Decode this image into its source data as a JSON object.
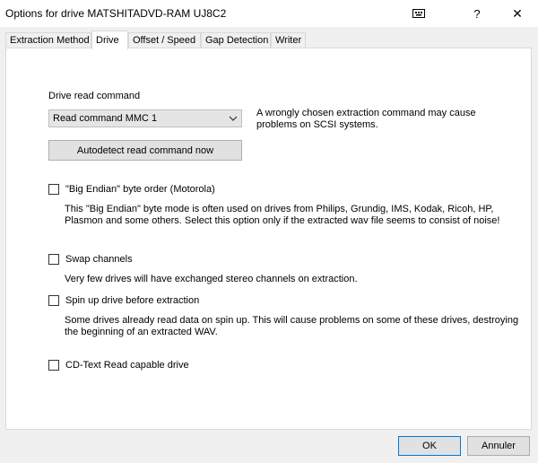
{
  "window": {
    "title": "Options for drive MATSHITADVD-RAM UJ8C2",
    "help_label": "?",
    "close_label": "✕"
  },
  "tabs": [
    {
      "label": "Extraction Method"
    },
    {
      "label": "Drive"
    },
    {
      "label": "Offset / Speed"
    },
    {
      "label": "Gap Detection"
    },
    {
      "label": "Writer"
    }
  ],
  "drive": {
    "read_command_label": "Drive read command",
    "read_command_value": "Read command MMC 1",
    "read_command_warning_1": "A wrongly chosen extraction command may cause",
    "read_command_warning_2": "problems on SCSI systems.",
    "autodetect_label": "Autodetect read command now",
    "big_endian_label": "\"Big Endian\" byte order (Motorola)",
    "big_endian_desc_1": "This \"Big Endian\" byte mode is often used on drives from Philips, Grundig, IMS, Kodak, Ricoh, HP,",
    "big_endian_desc_2": "Plasmon and some others. Select this option only if the extracted wav file seems to consist of noise!",
    "swap_label": "Swap channels",
    "swap_desc": "Very few drives will have exchanged stereo channels on extraction.",
    "spinup_label": "Spin up drive before extraction",
    "spinup_desc_1": "Some drives already read data on spin up. This will cause problems on some of these drives, destroying",
    "spinup_desc_2": "the beginning of an extracted WAV.",
    "cdtext_label": "CD-Text Read capable drive"
  },
  "footer": {
    "ok_label": "OK",
    "cancel_label": "Annuler"
  }
}
